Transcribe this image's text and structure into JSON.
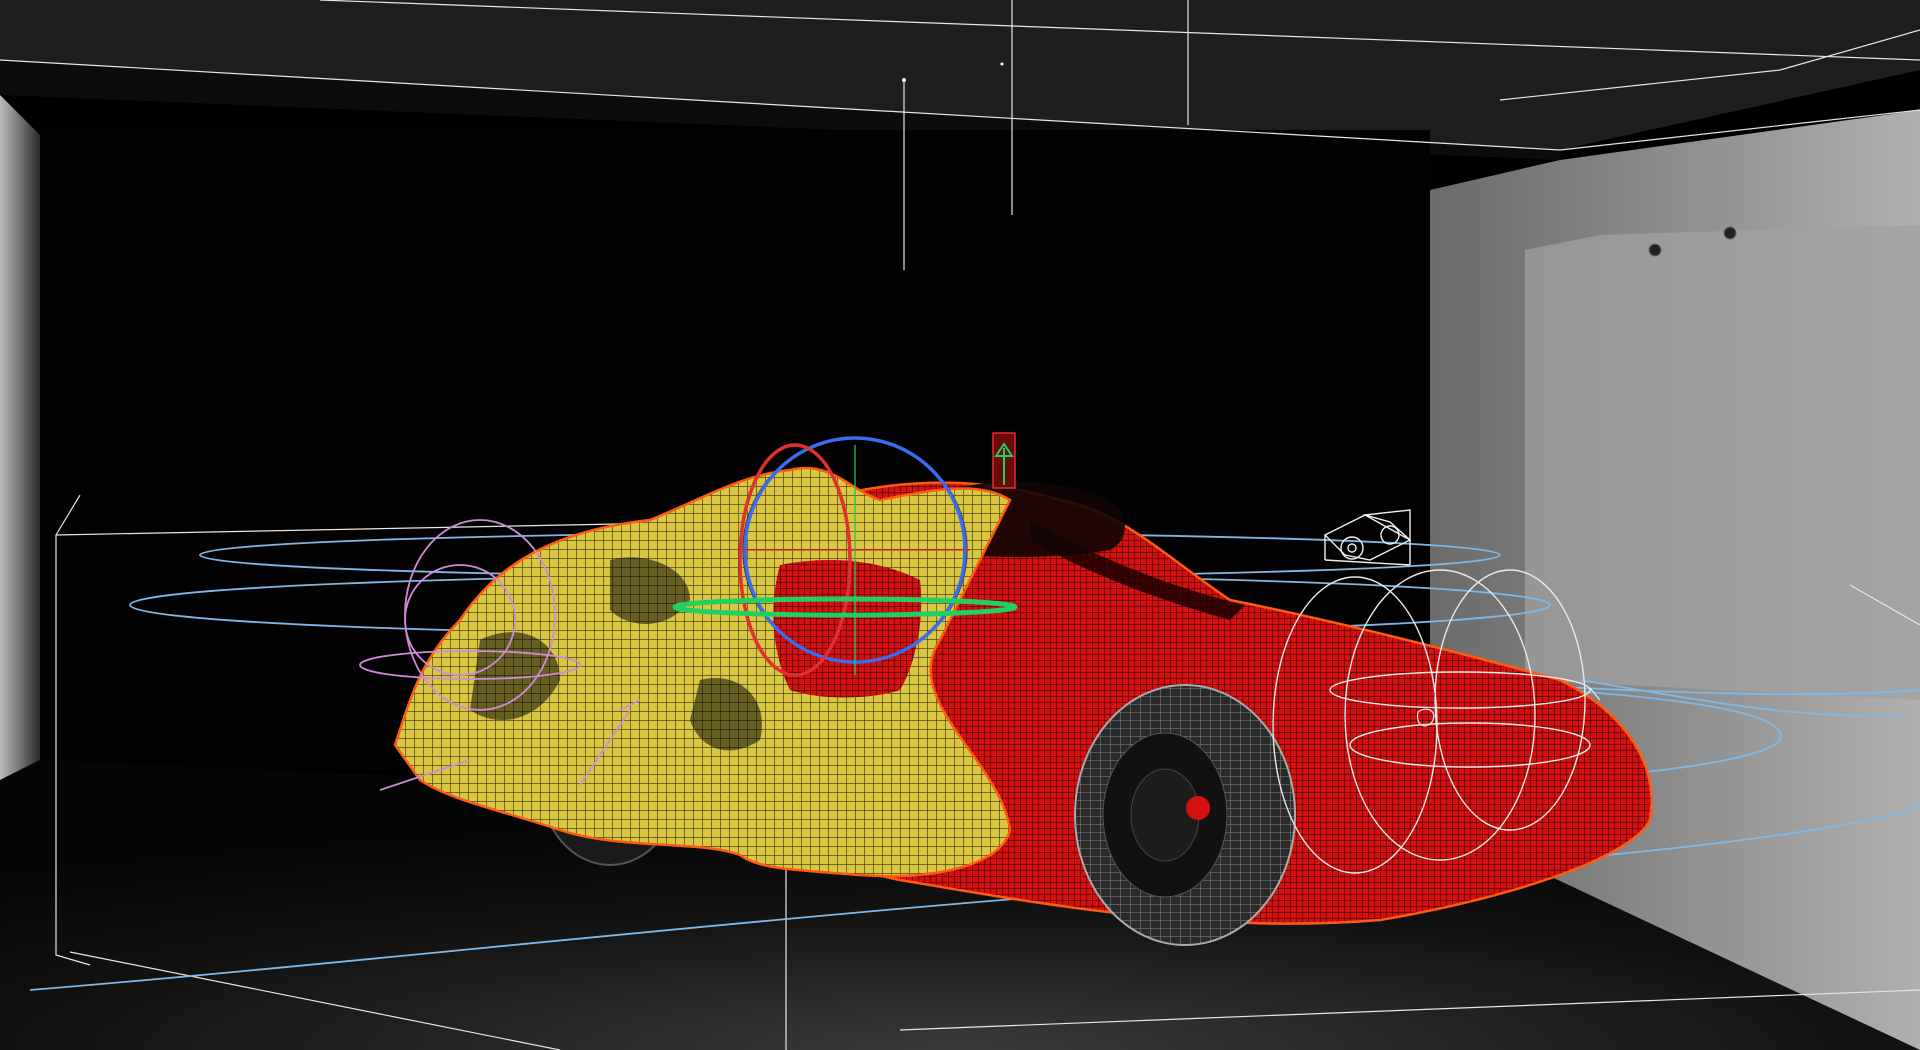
{
  "scene": {
    "colors": {
      "background": "#000000",
      "studio_wall": "#141414",
      "studio_light": "#9a9a9a",
      "mesh_yellow": "#e8d54a",
      "mesh_red": "#e81010",
      "selection_outline": "#ff5a10",
      "guide_line": "#ffffff",
      "orbit_curve": "#7fb8e6",
      "gizmo_x": "#e03030",
      "gizmo_y": "#20d060",
      "gizmo_z": "#3a6cf0",
      "deformer_pink": "#d08ad8"
    },
    "icons": {
      "camera": "camera-icon",
      "transform_gizmo": "rotate-gizmo-icon",
      "up_arrow": "arrow-up-icon",
      "spot_light": "spotlight-icon"
    }
  }
}
